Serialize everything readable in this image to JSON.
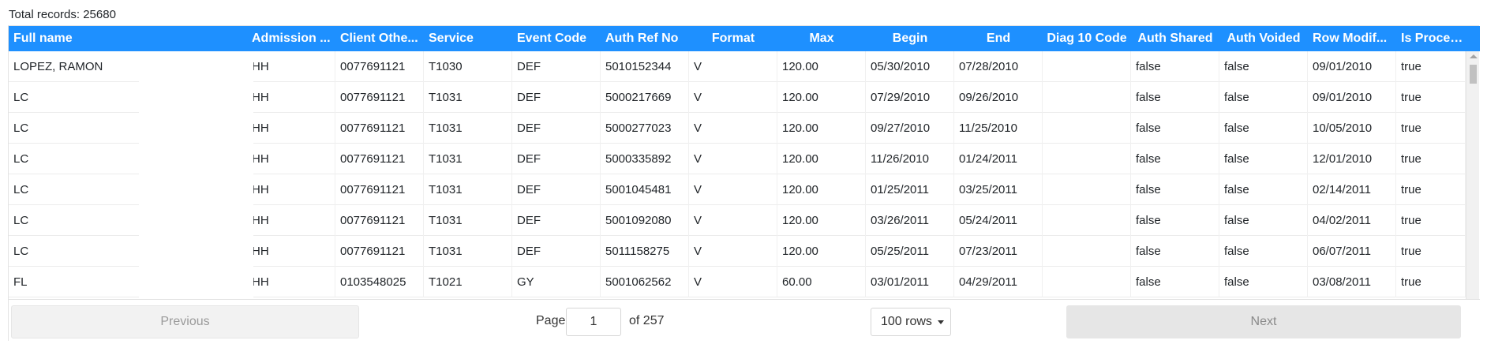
{
  "total_records": "Total records: 25680",
  "columns": [
    "Full name",
    "Admission ...",
    "Client Othe...",
    "Service",
    "Event Code",
    "Auth Ref No",
    "Format",
    "Max",
    "Begin",
    "End",
    "Diag 10 Code",
    "Auth Shared",
    "Auth Voided",
    "Row Modif...",
    "Is Processed"
  ],
  "rows": [
    [
      "LOPEZ, RAMON",
      "HH",
      "0077691121",
      "T1030",
      "DEF",
      "5010152344",
      "V",
      "120.00",
      "05/30/2010",
      "07/28/2010",
      "",
      "false",
      "false",
      "09/01/2010",
      "true"
    ],
    [
      "LC",
      "HH",
      "0077691121",
      "T1031",
      "DEF",
      "5000217669",
      "V",
      "120.00",
      "07/29/2010",
      "09/26/2010",
      "",
      "false",
      "false",
      "09/01/2010",
      "true"
    ],
    [
      "LC",
      "HH",
      "0077691121",
      "T1031",
      "DEF",
      "5000277023",
      "V",
      "120.00",
      "09/27/2010",
      "11/25/2010",
      "",
      "false",
      "false",
      "10/05/2010",
      "true"
    ],
    [
      "LC",
      "HH",
      "0077691121",
      "T1031",
      "DEF",
      "5000335892",
      "V",
      "120.00",
      "11/26/2010",
      "01/24/2011",
      "",
      "false",
      "false",
      "12/01/2010",
      "true"
    ],
    [
      "LC",
      "HH",
      "0077691121",
      "T1031",
      "DEF",
      "5001045481",
      "V",
      "120.00",
      "01/25/2011",
      "03/25/2011",
      "",
      "false",
      "false",
      "02/14/2011",
      "true"
    ],
    [
      "LC",
      "HH",
      "0077691121",
      "T1031",
      "DEF",
      "5001092080",
      "V",
      "120.00",
      "03/26/2011",
      "05/24/2011",
      "",
      "false",
      "false",
      "04/02/2011",
      "true"
    ],
    [
      "LC",
      "HH",
      "0077691121",
      "T1031",
      "DEF",
      "5011158275",
      "V",
      "120.00",
      "05/25/2011",
      "07/23/2011",
      "",
      "false",
      "false",
      "06/07/2011",
      "true"
    ],
    [
      "FL",
      "HH",
      "0103548025",
      "T1021",
      "GY",
      "5001062562",
      "V",
      "60.00",
      "03/01/2011",
      "04/29/2011",
      "",
      "false",
      "false",
      "03/08/2011",
      "true"
    ]
  ],
  "pager": {
    "previous": "Previous",
    "page_label": "Page",
    "page_value": "1",
    "of_label": "of 257",
    "rows_per_page": "100 rows",
    "next": "Next"
  }
}
